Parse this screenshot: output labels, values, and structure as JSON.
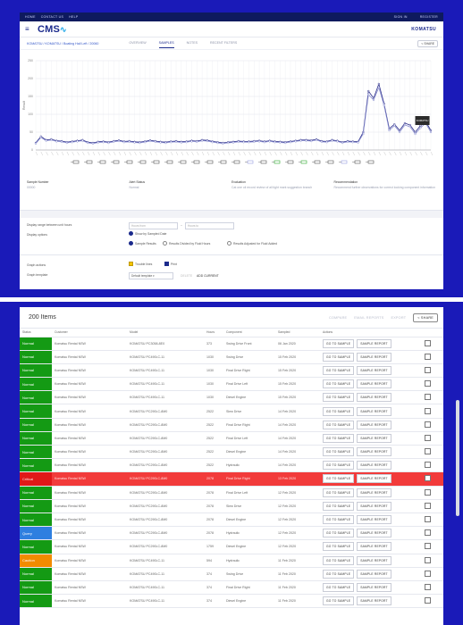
{
  "topbar": {
    "left": [
      "HOME",
      "CONTACT US",
      "HELP"
    ],
    "right": [
      "SIGN IN",
      "REGISTER"
    ]
  },
  "app": {
    "logo": "CMS",
    "brand": "KOMATSU"
  },
  "crumb": "KOMATSU / KOMATSU / Boating Hall Left / 20060",
  "tabs": [
    "OVERVIEW",
    "SAMPLES",
    "NOTES",
    "RECENT FILTERS"
  ],
  "share_label": "SHARE",
  "colors": {
    "frame": "#1a1ab8",
    "brand": "#1b2a8c",
    "normal": "#149a14",
    "critical": "#e01818",
    "query": "#2e7fe0",
    "caution": "#f28b00",
    "series_a": "#2d2f8a",
    "series_b": "#8a8fd0"
  },
  "chart_data": {
    "type": "line",
    "ylabel": "Result",
    "ylim": [
      0,
      250
    ],
    "yticks": [
      0,
      50,
      100,
      150,
      200,
      250
    ],
    "series": [
      {
        "name": "",
        "values": [
          20,
          38,
          28,
          30,
          26,
          25,
          22,
          24,
          26,
          28,
          22,
          20,
          23,
          24,
          22,
          25,
          27,
          24,
          25,
          23,
          22,
          24,
          27,
          25,
          23,
          22,
          24,
          25,
          23,
          24,
          26,
          25,
          28,
          27,
          24,
          22,
          20,
          22,
          23,
          25,
          24,
          24,
          25,
          26,
          24,
          26,
          24,
          23,
          22,
          24,
          26,
          28,
          28,
          27,
          30,
          25,
          24,
          28,
          26,
          22,
          25,
          24,
          23,
          50,
          165,
          145,
          185,
          130,
          60,
          72,
          55,
          75,
          70,
          50,
          68,
          80,
          55
        ]
      },
      {
        "name": "",
        "values": [
          18,
          35,
          26,
          28,
          24,
          23,
          20,
          22,
          24,
          26,
          20,
          18,
          21,
          22,
          20,
          23,
          25,
          22,
          23,
          21,
          20,
          22,
          25,
          23,
          21,
          20,
          22,
          23,
          21,
          22,
          24,
          23,
          26,
          25,
          22,
          20,
          18,
          20,
          21,
          23,
          22,
          22,
          23,
          24,
          22,
          24,
          22,
          21,
          20,
          22,
          24,
          26,
          26,
          25,
          28,
          23,
          22,
          26,
          24,
          20,
          23,
          22,
          21,
          45,
          155,
          140,
          175,
          125,
          55,
          68,
          50,
          70,
          65,
          45,
          62,
          75,
          50
        ]
      }
    ],
    "annotation": "KOMATSU"
  },
  "info": [
    {
      "k": "Sample Number",
      "v": "00000"
    },
    {
      "k": "Alert Status",
      "v": "Normal"
    },
    {
      "k": "Evaluation",
      "v": "Cat one oil record review of all tight mark suggestion branch"
    },
    {
      "k": "Recommendation",
      "v": "Recommend further observations for correct looking component information"
    }
  ],
  "controls": {
    "range_label": "Display range between unit hours",
    "from_placeholder": "Hours from",
    "to_placeholder": "Hours to",
    "display_options": "Display options",
    "show_all": "Show by Sampled Date",
    "radios": [
      "Sample Results",
      "Results Divided by Fluid Hours",
      "Results Adjusted for Fluid Added"
    ],
    "graph_actions": "Graph actions",
    "trouble": "Trouble lines",
    "print": "Print",
    "template_label": "Graph template",
    "template_value": "Default template",
    "delete": "DELETE",
    "add": "ADD CURRENT"
  },
  "list": {
    "title": "200 Items",
    "actions": [
      "COMPARE",
      "EMAIL REPORTS",
      "EXPORT",
      "SHARE"
    ],
    "headers": [
      "Status",
      "Customer",
      "Model",
      "Hours",
      "Component",
      "Sampled",
      "Actions",
      ""
    ],
    "btn_go": "GO TO SAMPLE",
    "btn_report": "SAMPLE REPORT",
    "rows": [
      {
        "status": "Normal",
        "color": "#149a14",
        "customer": "Komatsu Rental NSW",
        "model": "KOMATSU PC3058-8E0",
        "hours": "373",
        "component": "Swing Drive Front",
        "sampled": "06 Jan 2020"
      },
      {
        "status": "Normal",
        "color": "#149a14",
        "customer": "Komatsu Rental NSW",
        "model": "KOMATSU PC490LC-11",
        "hours": "1030",
        "component": "Swing Drive",
        "sampled": "15 Feb 2020"
      },
      {
        "status": "Normal",
        "color": "#149a14",
        "customer": "Komatsu Rental NSW",
        "model": "KOMATSU PC490LC-11",
        "hours": "1030",
        "component": "Final Drive Right",
        "sampled": "15 Feb 2020"
      },
      {
        "status": "Normal",
        "color": "#149a14",
        "customer": "Komatsu Rental NSW",
        "model": "KOMATSU PC490LC-11",
        "hours": "1030",
        "component": "Final Drive Left",
        "sampled": "15 Feb 2020"
      },
      {
        "status": "Normal",
        "color": "#149a14",
        "customer": "Komatsu Rental NSW",
        "model": "KOMATSU PC490LC-11",
        "hours": "1030",
        "component": "Diesel Engine",
        "sampled": "15 Feb 2020"
      },
      {
        "status": "Normal",
        "color": "#149a14",
        "customer": "Komatsu Rental NSW",
        "model": "KOMATSU PC290LC-8M0",
        "hours": "2522",
        "component": "Slew Drive",
        "sampled": "14 Feb 2020"
      },
      {
        "status": "Normal",
        "color": "#149a14",
        "customer": "Komatsu Rental NSW",
        "model": "KOMATSU PC290LC-8M0",
        "hours": "2522",
        "component": "Final Drive Right",
        "sampled": "14 Feb 2020"
      },
      {
        "status": "Normal",
        "color": "#149a14",
        "customer": "Komatsu Rental NSW",
        "model": "KOMATSU PC290LC-8M0",
        "hours": "2522",
        "component": "Final Drive Left",
        "sampled": "14 Feb 2020"
      },
      {
        "status": "Normal",
        "color": "#149a14",
        "customer": "Komatsu Rental NSW",
        "model": "KOMATSU PC290LC-8M0",
        "hours": "2522",
        "component": "Diesel Engine",
        "sampled": "14 Feb 2020"
      },
      {
        "status": "Normal",
        "color": "#149a14",
        "customer": "Komatsu Rental NSW",
        "model": "KOMATSU PC290LC-8M0",
        "hours": "2522",
        "component": "Hydraulic",
        "sampled": "14 Feb 2020"
      },
      {
        "status": "Critical",
        "color": "#e01818",
        "customer": "Komatsu Rental NSW",
        "model": "KOMATSU PC290LC-8M0",
        "hours": "2078",
        "component": "Final Drive Right",
        "sampled": "13 Feb 2020",
        "crit": true
      },
      {
        "status": "Normal",
        "color": "#149a14",
        "customer": "Komatsu Rental NSW",
        "model": "KOMATSU PC290LC-8M0",
        "hours": "2078",
        "component": "Final Drive Left",
        "sampled": "12 Feb 2020"
      },
      {
        "status": "Normal",
        "color": "#149a14",
        "customer": "Komatsu Rental NSW",
        "model": "KOMATSU PC290LC-8M0",
        "hours": "2078",
        "component": "Slew Drive",
        "sampled": "12 Feb 2020"
      },
      {
        "status": "Normal",
        "color": "#149a14",
        "customer": "Komatsu Rental NSW",
        "model": "KOMATSU PC290LC-8M0",
        "hours": "2078",
        "component": "Diesel Engine",
        "sampled": "12 Feb 2020"
      },
      {
        "status": "Query",
        "color": "#2e7fe0",
        "customer": "Komatsu Rental NSW",
        "model": "KOMATSU PC290LC-8M0",
        "hours": "2078",
        "component": "Hydraulic",
        "sampled": "12 Feb 2020"
      },
      {
        "status": "Normal",
        "color": "#149a14",
        "customer": "Komatsu Rental NSW",
        "model": "KOMATSU PC290LC-8M0",
        "hours": "1759",
        "component": "Diesel Engine",
        "sampled": "12 Feb 2020"
      },
      {
        "status": "Caution",
        "color": "#f28b00",
        "customer": "Komatsu Rental NSW",
        "model": "KOMATSU PC490LC-11",
        "hours": "594",
        "component": "Hydraulic",
        "sampled": "11 Feb 2020"
      },
      {
        "status": "Normal",
        "color": "#149a14",
        "customer": "Komatsu Rental NSW",
        "model": "KOMATSU PC490LC-11",
        "hours": "374",
        "component": "Swing Drive",
        "sampled": "11 Feb 2020"
      },
      {
        "status": "Normal",
        "color": "#149a14",
        "customer": "Komatsu Rental NSW",
        "model": "KOMATSU PC490LC-11",
        "hours": "374",
        "component": "Final Drive Right",
        "sampled": "11 Feb 2020"
      },
      {
        "status": "Normal",
        "color": "#149a14",
        "customer": "Komatsu Rental NSW",
        "model": "KOMATSU PC490LC-11",
        "hours": "374",
        "component": "Diesel Engine",
        "sampled": "11 Feb 2020"
      }
    ]
  }
}
